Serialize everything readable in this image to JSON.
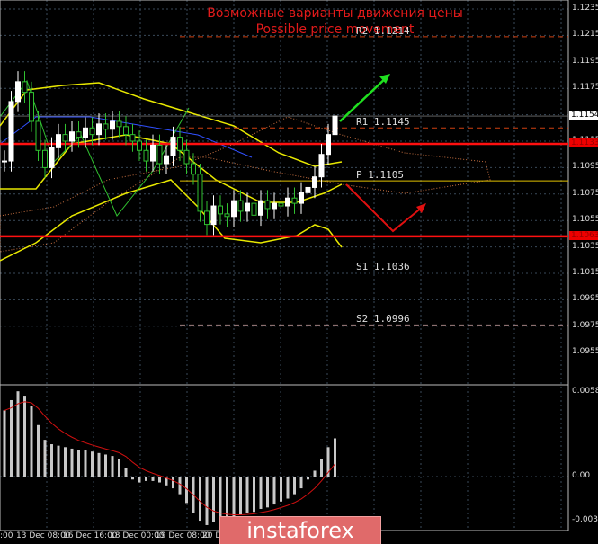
{
  "title_ru": "Возможные варианты движения цены",
  "title_en": "Possible price movement",
  "levels": [
    {
      "name": "R2",
      "value": 1.1214,
      "label": "R2 1.1214",
      "color": "#d04010"
    },
    {
      "name": "R1",
      "value": 1.1145,
      "label": "R1 1.1145",
      "color": "#d04010"
    },
    {
      "name": "P",
      "value": 1.1105,
      "label": "P 1.1105",
      "color": "#e0c000"
    },
    {
      "name": "S1",
      "value": 1.1036,
      "label": "S1 1.1036",
      "color": "#a08080"
    },
    {
      "name": "S2",
      "value": 1.0996,
      "label": "S2 1.0996",
      "color": "#a08080"
    }
  ],
  "support_resistance": [
    {
      "value": 1.1133,
      "label": "1.1133"
    },
    {
      "value": 1.1063,
      "label": "1.1063"
    }
  ],
  "current_price": {
    "value": 1.1154,
    "label": "1.1154"
  },
  "price_axis": [
    "1.1235",
    "1.1215",
    "1.1195",
    "1.1175",
    "1.1115",
    "1.1095",
    "1.1075",
    "1.1055",
    "1.1035",
    "1.1015",
    "1.0995",
    "1.0975",
    "1.0955"
  ],
  "osc_axis": [
    "0.00581",
    "0.00",
    "-0.00339"
  ],
  "time_axis": [
    ":00",
    "13 Dec 08:00",
    "16 Dec 16:00",
    "18 Dec 00:00",
    "19 Dec 08:00",
    "20 De"
  ],
  "closes": [
    1.112,
    1.1165,
    1.118,
    1.1172,
    1.115,
    1.1128,
    1.1115,
    1.113,
    1.114,
    1.1135,
    1.1142,
    1.1138,
    1.1145,
    1.114,
    1.1148,
    1.1144,
    1.115,
    1.1146,
    1.114,
    1.1135,
    1.1128,
    1.112,
    1.1132,
    1.1118,
    1.1124,
    1.1138,
    1.1128,
    1.1118,
    1.111,
    1.1082,
    1.1072,
    1.1086,
    1.108,
    1.1078,
    1.109,
    1.1082,
    1.1088,
    1.1079,
    1.109,
    1.1084,
    1.1088,
    1.1086,
    1.1092,
    1.1088,
    1.1096,
    1.11,
    1.1108,
    1.1125,
    1.114,
    1.1154
  ],
  "oscillator": [
    0.0045,
    0.0052,
    0.0058,
    0.0055,
    0.0048,
    0.0035,
    0.0025,
    0.0022,
    0.0021,
    0.002,
    0.0019,
    0.0018,
    0.0018,
    0.0017,
    0.0016,
    0.0015,
    0.0014,
    0.0012,
    0.0006,
    -0.0002,
    -0.0004,
    -0.0003,
    -0.0003,
    -0.0004,
    -0.0006,
    -0.0008,
    -0.0012,
    -0.0018,
    -0.0025,
    -0.003,
    -0.0033,
    -0.0031,
    -0.0029,
    -0.0028,
    -0.0027,
    -0.0026,
    -0.0025,
    -0.0024,
    -0.0022,
    -0.0021,
    -0.0019,
    -0.0017,
    -0.0015,
    -0.0012,
    -0.0008,
    -0.0002,
    0.0004,
    0.0012,
    0.002,
    0.0026
  ],
  "brand": "instaforex"
}
